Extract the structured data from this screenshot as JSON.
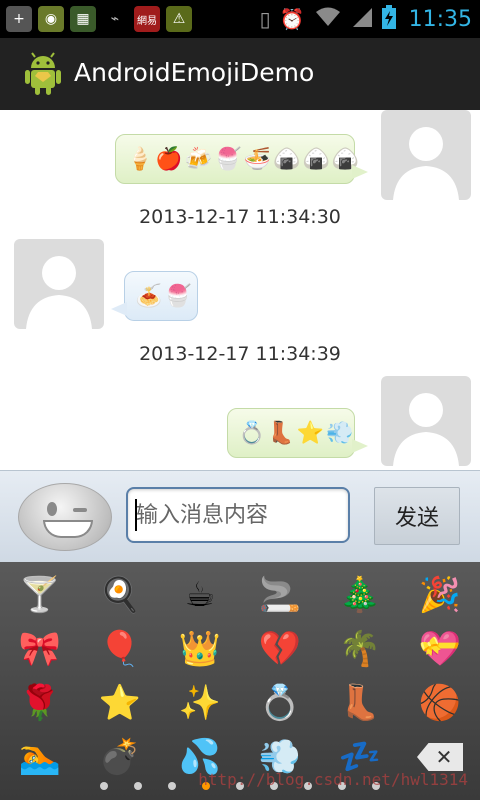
{
  "status_bar": {
    "time": "11:35",
    "left_icons": [
      "add-icon",
      "game-icon",
      "chip-icon",
      "usb-icon",
      "app-notification-icon",
      "game-alert-icon"
    ],
    "left_icon_glyphs": [
      "+",
      "◉",
      "▦",
      "⌁",
      "網易",
      "⚠"
    ],
    "right_icons": [
      "vibrate-icon",
      "alarm-icon",
      "wifi-icon",
      "signal-icon",
      "battery-charging-icon"
    ]
  },
  "action_bar": {
    "title": "AndroidEmojiDemo"
  },
  "messages": [
    {
      "direction": "out",
      "emojis": [
        "🍦",
        "🍎",
        "🍻",
        "🍧",
        "🍜",
        "🍙",
        "🍙",
        "🍙"
      ]
    },
    {
      "timestamp": "2013-12-17 11:34:30"
    },
    {
      "direction": "in",
      "emojis": [
        "🍝",
        "🍧"
      ]
    },
    {
      "timestamp": "2013-12-17 11:34:39"
    },
    {
      "direction": "out",
      "emojis": [
        "💍",
        "👢",
        "⭐",
        "💨"
      ]
    }
  ],
  "input": {
    "placeholder": "输入消息内容",
    "value": "",
    "send_label": "发送"
  },
  "emoji_panel": {
    "grid": [
      [
        "🍸",
        "🍳",
        "☕",
        "🚬",
        "🎄",
        "🎉"
      ],
      [
        "🎀",
        "🎈",
        "👑",
        "💔",
        "🌴",
        "💝"
      ],
      [
        "🌹",
        "⭐",
        "✨",
        "💍",
        "👢",
        "🏀"
      ],
      [
        "🏊",
        "💣",
        "💦",
        "💨",
        "💤",
        "delete"
      ]
    ],
    "delete_label": "✕",
    "page_count": 9,
    "active_page": 3,
    "watermark": "http://blog.csdn.net/hwl1314"
  }
}
